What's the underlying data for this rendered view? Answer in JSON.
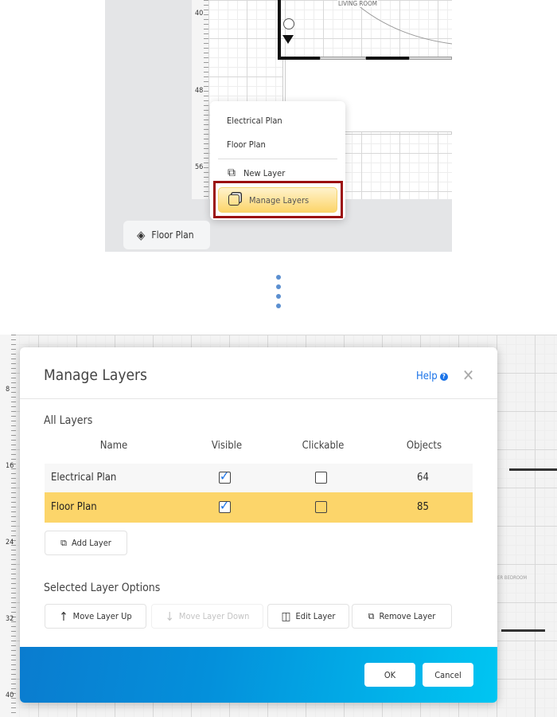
{
  "top": {
    "ruler_labels": [
      "40",
      "48",
      "56"
    ],
    "room_label": "LIVING ROOM",
    "menu": {
      "items": [
        {
          "label": "Electrical Plan"
        },
        {
          "label": "Floor Plan"
        }
      ],
      "new_layer": "New Layer",
      "manage_layers": "Manage Layers"
    },
    "layer_button": "Floor Plan"
  },
  "bottom": {
    "ruler_labels": [
      "8",
      "16",
      "24",
      "32",
      "40"
    ],
    "room_label": "ER BEDROOM",
    "dialog": {
      "title": "Manage Layers",
      "help": "Help",
      "all_layers": "All Layers",
      "columns": [
        "Name",
        "Visible",
        "Clickable",
        "Objects"
      ],
      "rows": [
        {
          "name": "Electrical Plan",
          "visible": true,
          "clickable": false,
          "objects": "64",
          "selected": false
        },
        {
          "name": "Floor Plan",
          "visible": true,
          "clickable": false,
          "objects": "85",
          "selected": true
        }
      ],
      "add_layer": "Add Layer",
      "selected_options": "Selected Layer Options",
      "move_up": "Move Layer Up",
      "move_down": "Move Layer Down",
      "edit": "Edit Layer",
      "remove": "Remove Layer",
      "ok": "OK",
      "cancel": "Cancel"
    }
  },
  "colors": {
    "highlight": "#fcd56a",
    "accent": "#1a73e8",
    "callout": "#9b1010"
  }
}
